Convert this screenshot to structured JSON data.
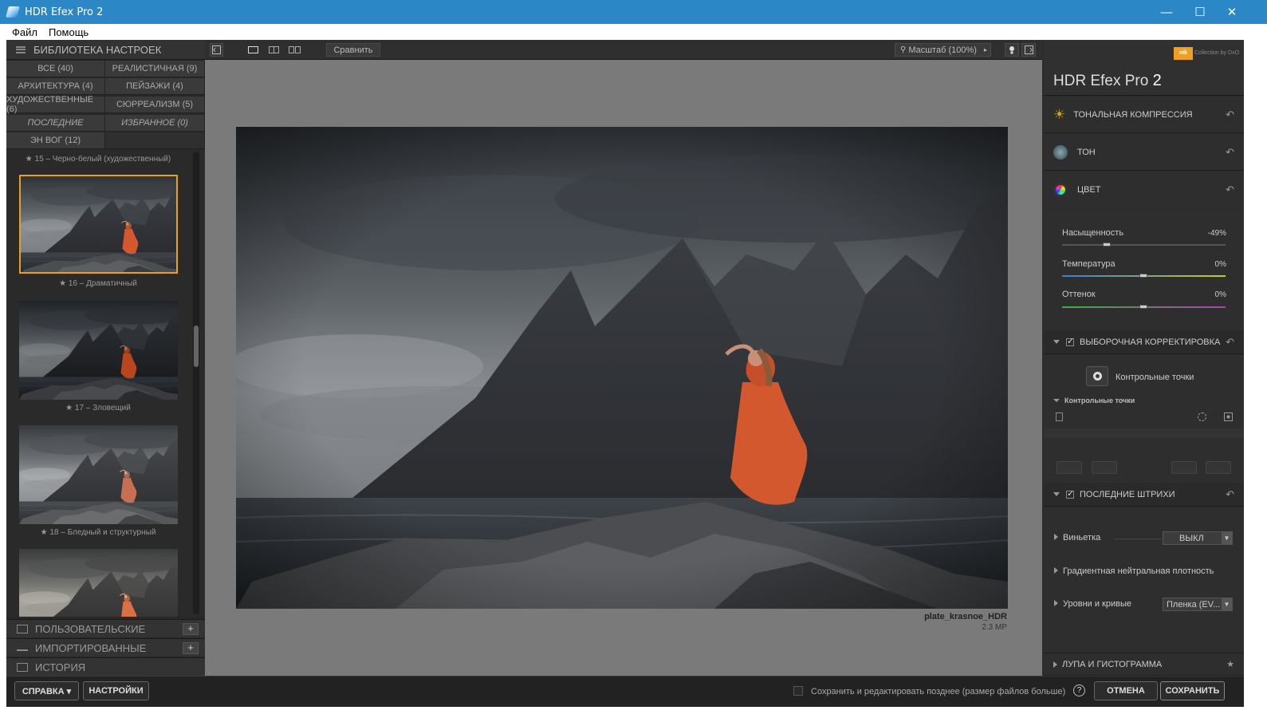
{
  "window": {
    "title": "HDR Efex Pro 2",
    "minimize": "—",
    "maximize": "☐",
    "close": "✕"
  },
  "menu": {
    "file": "Файл",
    "help": "Помощь"
  },
  "library": {
    "header": "БИБЛИОТЕКА НАСТРОЕК",
    "categories": [
      "ВСЕ (40)",
      "РЕАЛИСТИЧНАЯ (9)",
      "АРХИТЕКТУРА (4)",
      "ПЕЙЗАЖИ (4)",
      "ХУДОЖЕСТВЕННЫЕ (6)",
      "СЮРРЕАЛИЗМ (5)",
      "ПОСЛЕДНИЕ",
      "ИЗБРАННОЕ (0)",
      "ЭН ВОГ (12)"
    ],
    "presets": [
      "★ 15 – Черно-белый (художественный)",
      "★ 16 – Драматичный",
      "★ 17 – Зловещий",
      "★ 18 – Бледный и структурный"
    ],
    "sections": [
      "ПОЛЬЗОВАТЕЛЬСКИЕ",
      "ИМПОРТИРОВАННЫЕ",
      "ИСТОРИЯ"
    ],
    "plus": "+"
  },
  "toolbar": {
    "compare": "Сравнить",
    "zoom": "Масштаб (100%)"
  },
  "image": {
    "filename": "plate_krasnoe_HDR",
    "size": "2.3 MP"
  },
  "right": {
    "brand_logo": "nik",
    "brand_sub": "Collection by DxO",
    "product": "HDR Efex Pro",
    "version": "2",
    "sections": {
      "tonal": "ТОНАЛЬНАЯ КОМПРЕССИЯ",
      "tone": "ТОН",
      "color": "ЦВЕТ"
    },
    "sliders": [
      {
        "label": "Насыщенность",
        "value": "-49%",
        "level": 0.27
      },
      {
        "label": "Температура",
        "value": "0%",
        "level": 0.5
      },
      {
        "label": "Оттенок",
        "value": "0%",
        "level": 0.5
      }
    ],
    "selective": "ВЫБОРОЧНАЯ КОРРЕКТИРОВКА",
    "control_points_btn": "Контрольные точки",
    "control_points_sub": "Контрольные точки",
    "finishing": "ПОСЛЕДНИЕ ШТРИХИ",
    "vignette": "Виньетка",
    "vignette_value": "ВЫКЛ",
    "gradient": "Градиентная нейтральная плотность",
    "levels": "Уровни и кривые",
    "levels_value": "Пленка (EV...",
    "loupe": "ЛУПА И ГИСТОГРАММА"
  },
  "bottom": {
    "help": "СПРАВКА ▾",
    "settings": "НАСТРОЙКИ",
    "save_later": "Сохранить и редактировать позднее (размер файлов больше)",
    "help_icon": "?",
    "cancel": "ОТМЕНА",
    "save": "СОХРАНИТЬ"
  },
  "colors": {
    "accent": "#e8a020",
    "titlebar": "#2b87c6",
    "dress": "#d4582e"
  }
}
